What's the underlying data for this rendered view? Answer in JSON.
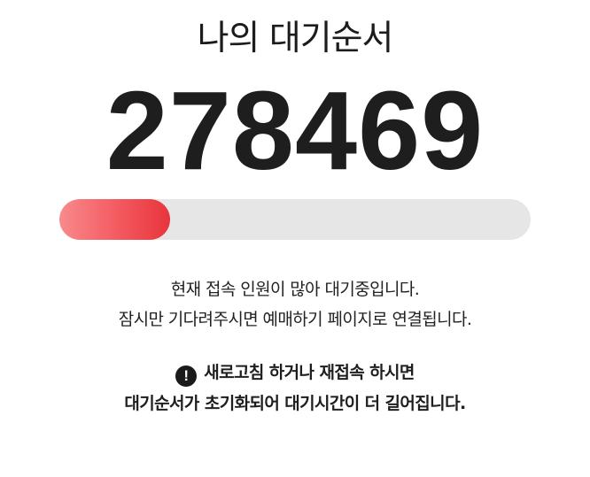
{
  "queue": {
    "title": "나의 대기순서",
    "number": "278469",
    "progress_fraction": 0.235
  },
  "info": {
    "line1": "현재 접속 인원이 많아 대기중입니다.",
    "line2": "잠시만 기다려주시면 예매하기 페이지로 연결됩니다."
  },
  "warning": {
    "icon": "exclamation-circle-icon",
    "icon_glyph": "!",
    "line1": "새로고침 하거나 재접속 하시면",
    "line2": "대기순서가 초기화되어 대기시간이 더 길어집니다."
  },
  "colors": {
    "progress_fill": "#f2545a",
    "progress_track": "#e6e6e6"
  }
}
